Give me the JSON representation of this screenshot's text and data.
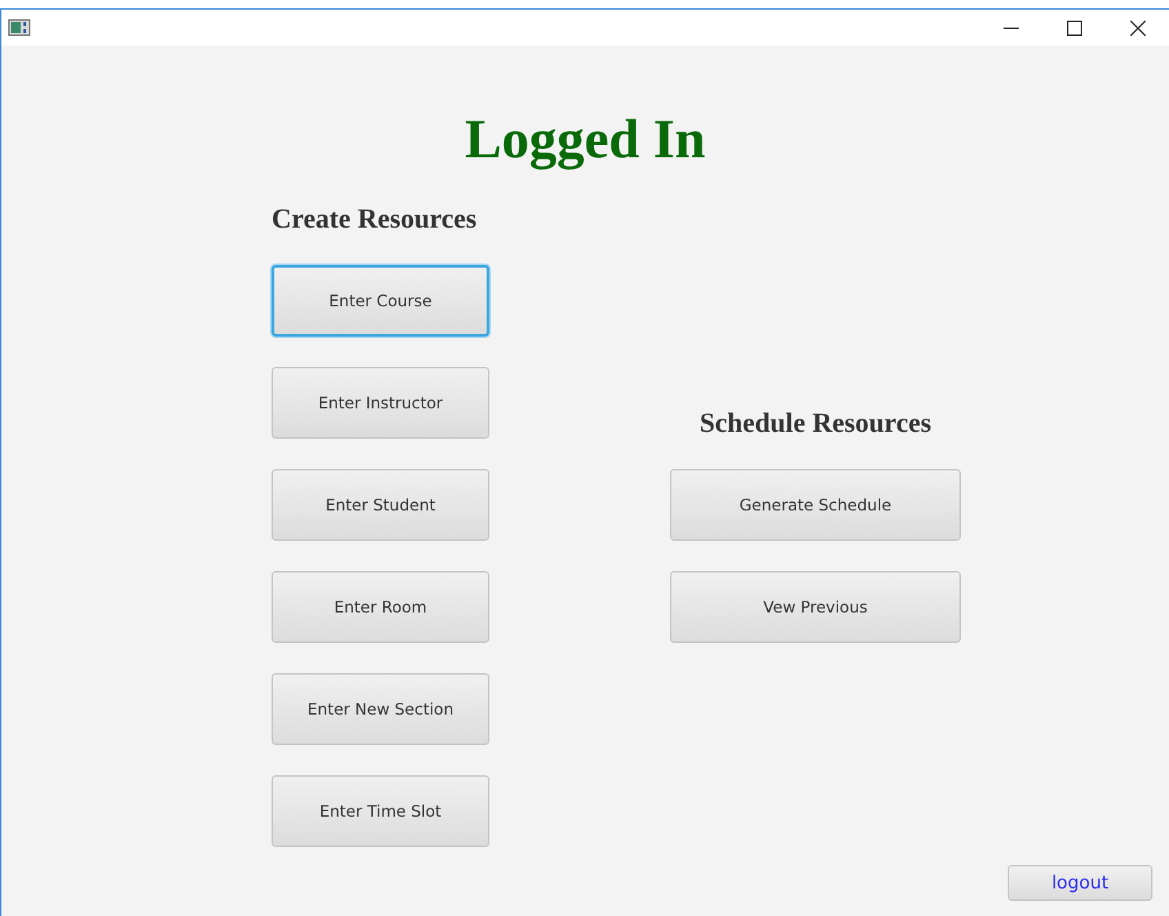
{
  "heading": "Logged In",
  "create": {
    "title": "Create Resources",
    "buttons": [
      {
        "label": "Enter Course",
        "focused": true
      },
      {
        "label": "Enter Instructor",
        "focused": false
      },
      {
        "label": "Enter Student",
        "focused": false
      },
      {
        "label": "Enter Room",
        "focused": false
      },
      {
        "label": "Enter New Section",
        "focused": false
      },
      {
        "label": "Enter Time Slot",
        "focused": false
      }
    ]
  },
  "schedule": {
    "title": "Schedule Resources",
    "buttons": [
      {
        "label": "Generate Schedule",
        "focused": false
      },
      {
        "label": "Vew Previous",
        "focused": false
      }
    ]
  },
  "logout": {
    "label": "logout"
  }
}
